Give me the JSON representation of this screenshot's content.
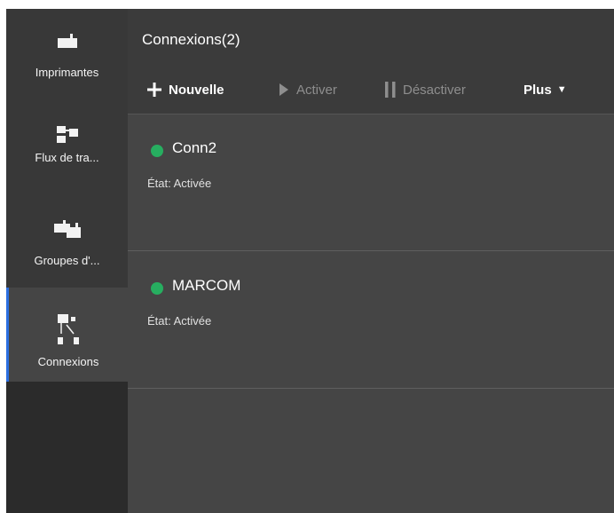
{
  "sidebar": {
    "items": [
      {
        "label": "Imprimantes",
        "icon": "printer-icon"
      },
      {
        "label": "Flux de tra...",
        "icon": "workflow-icon"
      },
      {
        "label": "Groupes d'...",
        "icon": "printer-group-icon"
      },
      {
        "label": "Connexions",
        "icon": "connections-icon",
        "active": true
      }
    ]
  },
  "header": {
    "title": "Connexions",
    "count": "(2)"
  },
  "toolbar": {
    "new_label": "Nouvelle",
    "activate_label": "Activer",
    "deactivate_label": "Désactiver",
    "more_label": "Plus"
  },
  "connections": [
    {
      "name": "Conn2",
      "state": "État: Activée"
    },
    {
      "name": "MARCOM",
      "state": "État: Activée"
    }
  ],
  "colors": {
    "accent": "#2b6ee0",
    "status_active": "#27ae60"
  }
}
